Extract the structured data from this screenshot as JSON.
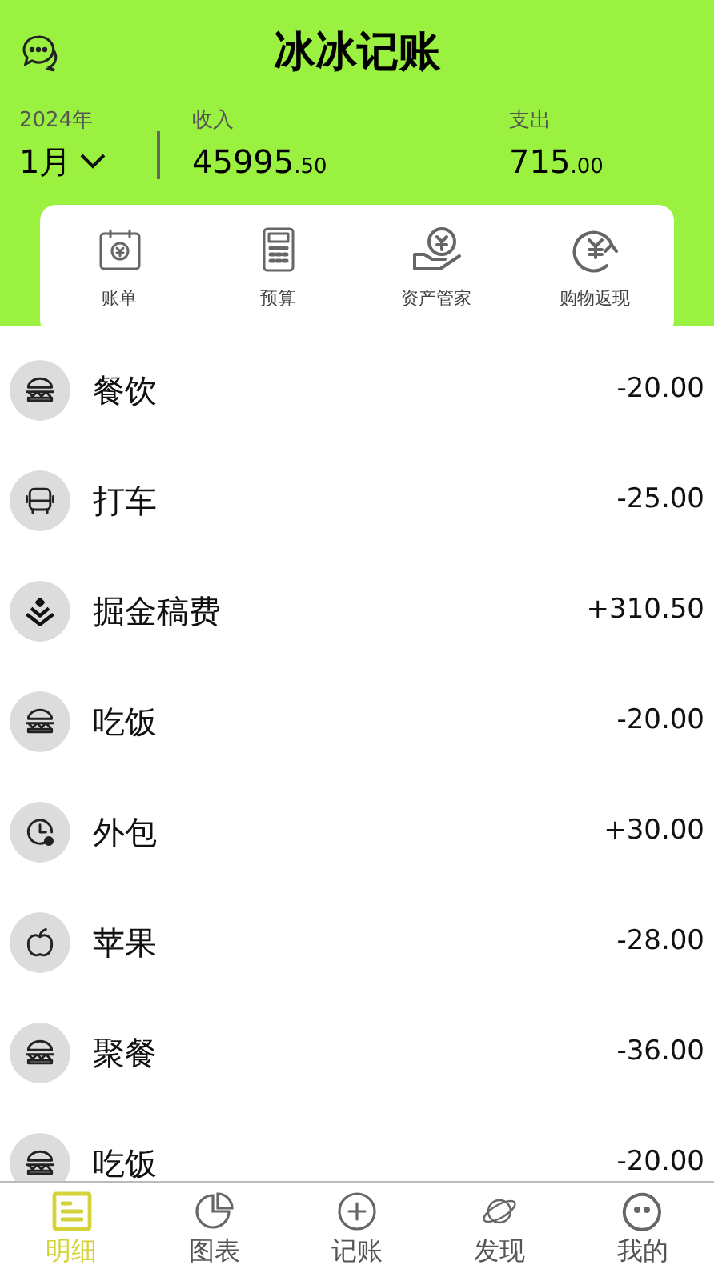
{
  "header": {
    "title": "冰冰记账",
    "year": "2024年",
    "month": "1月",
    "income": {
      "label": "收入",
      "integer": "45995",
      "decimal": ".50"
    },
    "expense": {
      "label": "支出",
      "integer": "715",
      "decimal": ".00"
    }
  },
  "shortcuts": [
    {
      "kind": "calendar",
      "label": "账单"
    },
    {
      "kind": "calculator",
      "label": "预算"
    },
    {
      "kind": "hand",
      "label": "资产管家"
    },
    {
      "kind": "refund",
      "label": "购物返现"
    }
  ],
  "records": [
    {
      "kind": "burger",
      "name": "餐饮",
      "amount": "-20.00"
    },
    {
      "kind": "bus",
      "name": "打车",
      "amount": "-25.00"
    },
    {
      "kind": "chevrons",
      "name": "掘金稿费",
      "amount": "+310.50"
    },
    {
      "kind": "burger",
      "name": "吃饭",
      "amount": "-20.00"
    },
    {
      "kind": "clock",
      "name": "外包",
      "amount": "+30.00"
    },
    {
      "kind": "apple",
      "name": "苹果",
      "amount": "-28.00"
    },
    {
      "kind": "burger",
      "name": "聚餐",
      "amount": "-36.00"
    },
    {
      "kind": "burger",
      "name": "吃饭",
      "amount": "-20.00"
    }
  ],
  "tabs": [
    {
      "kind": "list",
      "label": "明细",
      "selected": true
    },
    {
      "kind": "chart",
      "label": "图表",
      "selected": false
    },
    {
      "kind": "plus",
      "label": "记账",
      "selected": false
    },
    {
      "kind": "planet",
      "label": "发现",
      "selected": false
    },
    {
      "kind": "face",
      "label": "我的",
      "selected": false
    }
  ]
}
